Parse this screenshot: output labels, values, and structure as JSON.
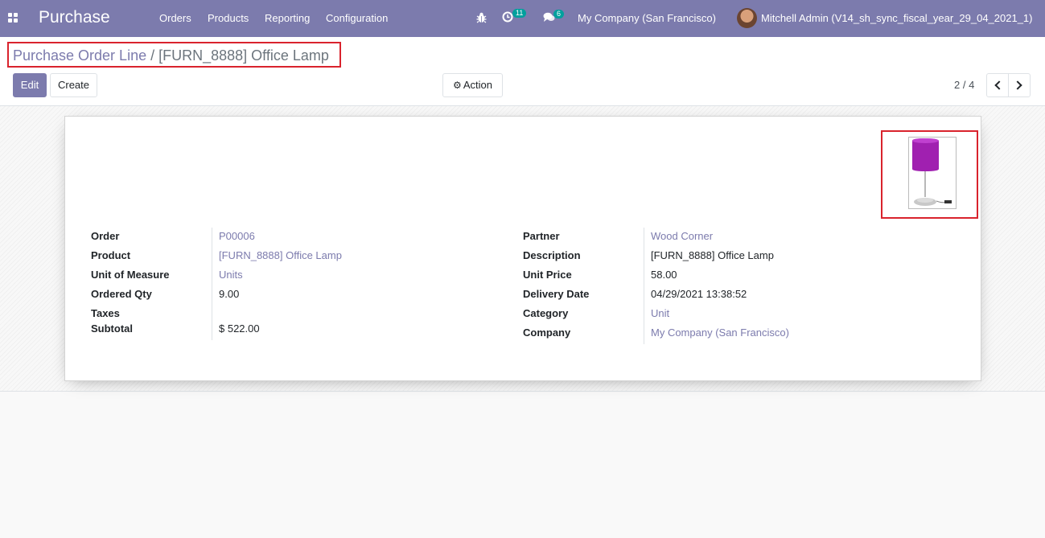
{
  "navbar": {
    "brand": "Purchase",
    "menu": [
      "Orders",
      "Products",
      "Reporting",
      "Configuration"
    ],
    "activity_count": "11",
    "messages_count": "6",
    "company": "My Company (San Francisco)",
    "user": "Mitchell Admin (V14_sh_sync_fiscal_year_29_04_2021_1)"
  },
  "breadcrumb": {
    "parent": "Purchase Order Line",
    "separator": "/",
    "current": "[FURN_8888] Office Lamp"
  },
  "buttons": {
    "edit": "Edit",
    "create": "Create",
    "action": "Action"
  },
  "pager": {
    "value": "2 / 4"
  },
  "form": {
    "left": {
      "order_label": "Order",
      "order_value": "P00006",
      "product_label": "Product",
      "product_value": "[FURN_8888] Office Lamp",
      "uom_label": "Unit of Measure",
      "uom_value": "Units",
      "qty_label": "Ordered Qty",
      "qty_value": "9.00",
      "taxes_label": "Taxes",
      "taxes_value": "",
      "subtotal_label": "Subtotal",
      "subtotal_value": "$ 522.00"
    },
    "right": {
      "partner_label": "Partner",
      "partner_value": "Wood Corner",
      "description_label": "Description",
      "description_value": "[FURN_8888] Office Lamp",
      "price_label": "Unit Price",
      "price_value": "58.00",
      "delivery_label": "Delivery Date",
      "delivery_value": "04/29/2021 13:38:52",
      "category_label": "Category",
      "category_value": "Unit",
      "company_label": "Company",
      "company_value": "My Company (San Francisco)"
    }
  },
  "colors": {
    "brand": "#7c7bad",
    "highlight": "#d9232d",
    "badge": "#00a09d",
    "lamp_shade": "#a020b0"
  },
  "icons": [
    "apps-icon",
    "bug-icon",
    "activity-clock-icon",
    "chat-icon",
    "gear-icon",
    "chevron-left-icon",
    "chevron-right-icon"
  ]
}
